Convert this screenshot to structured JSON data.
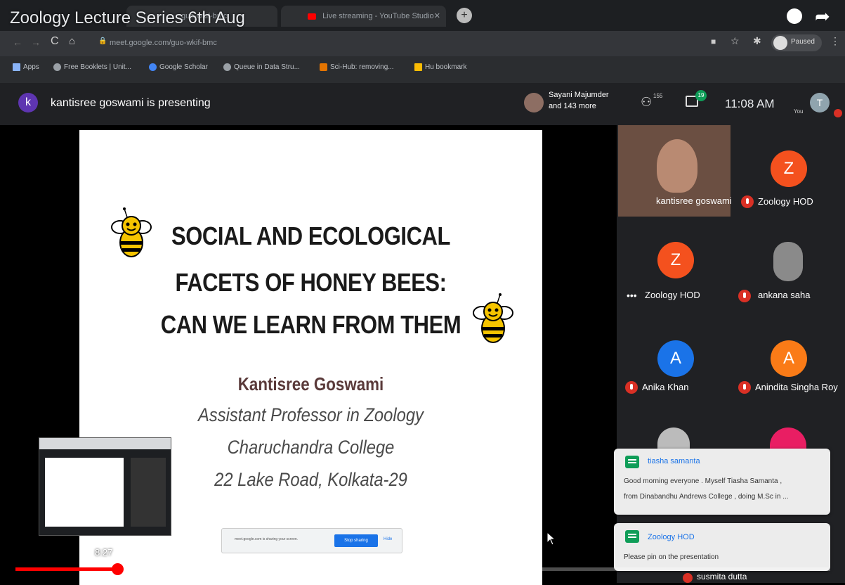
{
  "video": {
    "title": "Zoology Lecture Series 6th Aug",
    "timestamp": "8:27",
    "progress": 0.125
  },
  "browser": {
    "tabs": [
      {
        "label": "guo-wkif-bmc"
      },
      {
        "label": "Live streaming - YouTube Studio"
      }
    ],
    "url": "meet.google.com/guo-wkif-bmc",
    "profile_status": "Paused",
    "bookmarks": [
      {
        "label": "Apps",
        "color": "#8ab4f8"
      },
      {
        "label": "Free Booklets | Unit...",
        "color": "#9aa0a6"
      },
      {
        "label": "Google Scholar",
        "color": "#4285f4"
      },
      {
        "label": "Queue in Data Stru...",
        "color": "#9aa0a6"
      },
      {
        "label": "Sci-Hub: removing...",
        "color": "#e37400"
      },
      {
        "label": "Hu bookmark",
        "color": "#fbbc04"
      }
    ]
  },
  "meet": {
    "presenter_initial": "k",
    "presenting_text": "kantisree goswami is presenting",
    "participants_summary_line1": "Sayani Majumder",
    "participants_summary_line2": "and 143 more",
    "participant_count": "155",
    "chat_badge": "19",
    "time": "11:08 AM",
    "you_label": "You",
    "you_initial": "T"
  },
  "slide": {
    "title_line1": "SOCIAL AND ECOLOGICAL",
    "title_line2": "FACETS OF HONEY BEES:",
    "title_line3": "CAN WE LEARN FROM THEM",
    "author": "Kantisree Goswami",
    "position": "Assistant Professor in Zoology",
    "college": "Charuchandra College",
    "address": "22 Lake Road, Kolkata-29",
    "sharing_text": "meet.google.com is sharing your screen.",
    "stop_sharing": "Stop sharing",
    "hide": "Hide"
  },
  "tiles": [
    {
      "name": "kantisree goswami",
      "initial": "",
      "color": "#000000"
    },
    {
      "name": "Zoology HOD",
      "initial": "Z",
      "color": "#f4511e"
    },
    {
      "name": "Zoology HOD",
      "initial": "Z",
      "color": "#f4511e"
    },
    {
      "name": "ankana saha",
      "initial": "",
      "color": "#000000"
    },
    {
      "name": "Anika Khan",
      "initial": "A",
      "color": "#1a73e8"
    },
    {
      "name": "Anindita Singha Roy",
      "initial": "A",
      "color": "#fa7b17"
    }
  ],
  "chat": [
    {
      "sender": "tiasha samanta",
      "line1": "Good morning everyone . Myself Tiasha Samanta ,",
      "line2": "from Dinabandhu Andrews College , doing M.Sc in ..."
    },
    {
      "sender": "Zoology HOD",
      "line1": "Please pin on the presentation",
      "line2": ""
    }
  ],
  "bottom_partial_name": "susmita dutta"
}
